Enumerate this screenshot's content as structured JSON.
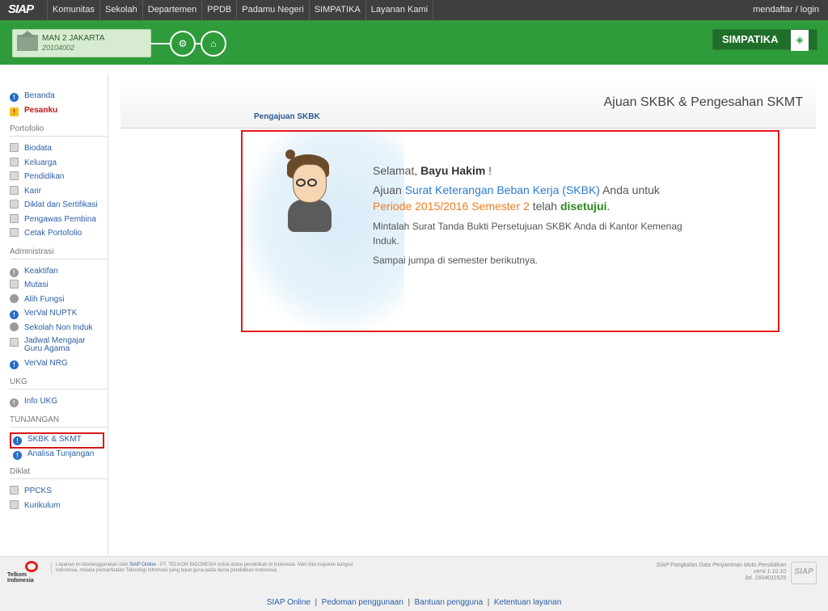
{
  "topnav": {
    "logo": "SIAP",
    "items": [
      "Komunitas",
      "Sekolah",
      "Departemen",
      "PPDB",
      "Padamu Negeri",
      "SIMPATIKA",
      "Layanan Kami"
    ],
    "login": "mendaftar / login"
  },
  "header": {
    "school_name": "MAN 2 JAKARTA",
    "school_id": "20104002",
    "brand": "SIMPATIKA"
  },
  "sidebar": {
    "beranda": "Beranda",
    "pesanku": "Pesanku",
    "portofolio_head": "Portofolio",
    "portofolio": [
      "Biodata",
      "Keluarga",
      "Pendidikan",
      "Karir",
      "Diklat dan Sertifikasi",
      "Pengawas Pembina",
      "Cetak Portofolio"
    ],
    "administrasi_head": "Administrasi",
    "administrasi": [
      "Keaktifan",
      "Mutasi",
      "Alih Fungsi",
      "VerVal NUPTK",
      "Sekolah Non Induk",
      "Jadwal Mengajar Guru Agama",
      "VerVal NRG"
    ],
    "ukg_head": "UKG",
    "ukg": [
      "Info UKG"
    ],
    "tunjangan_head": "TUNJANGAN",
    "tunjangan": [
      "SKBK & SKMT",
      "Analisa Tunjangan"
    ],
    "diklat_head": "Diklat",
    "diklat": [
      "PPCKS",
      "Kurikulum"
    ]
  },
  "main": {
    "title": "Ajuan SKBK & Pengesahan SKMT",
    "tab": "Pengajuan SKBK",
    "greeting_prefix": "Selamat, ",
    "user_name": "Bayu Hakim",
    "greeting_suffix": " !",
    "line1_prefix": "Ajuan ",
    "line1_link": "Surat Keterangan Beban Kerja (SKBK)",
    "line1_suffix": " Anda untuk ",
    "period": "Periode 2015/2016 Semester 2",
    "line1_tail": " telah ",
    "status": "disetujui",
    "status_end": ".",
    "note1": "Mintalah Surat Tanda Bukti Persetujuan SKBK Anda di Kantor Kemenag Induk.",
    "note2": "Sampai jumpa di semester berikutnya."
  },
  "footer": {
    "telkom": "Telkom Indonesia",
    "note_prefix": "Layanan ini diselenggarakan oleh ",
    "note_link": "SIAP Online",
    "note_rest": " - PT. TELKOM INDONESIA untuk dunia pendidikan di Indonesia. Mari kita majukan bangsa Indonesia, melalui pemanfaatan Teknologi Informasi yang tepat guna pada dunia pendidikan Indonesia.",
    "right1": "SIAP Pangkalan Data Penjaminan Mutu Pendidikan",
    "right2": "versi 1.10.10",
    "right3": "bd. 1604011629",
    "siap": "SIAP",
    "links": [
      "SIAP Online",
      "Pedoman penggunaan",
      "Bantuan pengguna",
      "Ketentuan layanan"
    ]
  }
}
